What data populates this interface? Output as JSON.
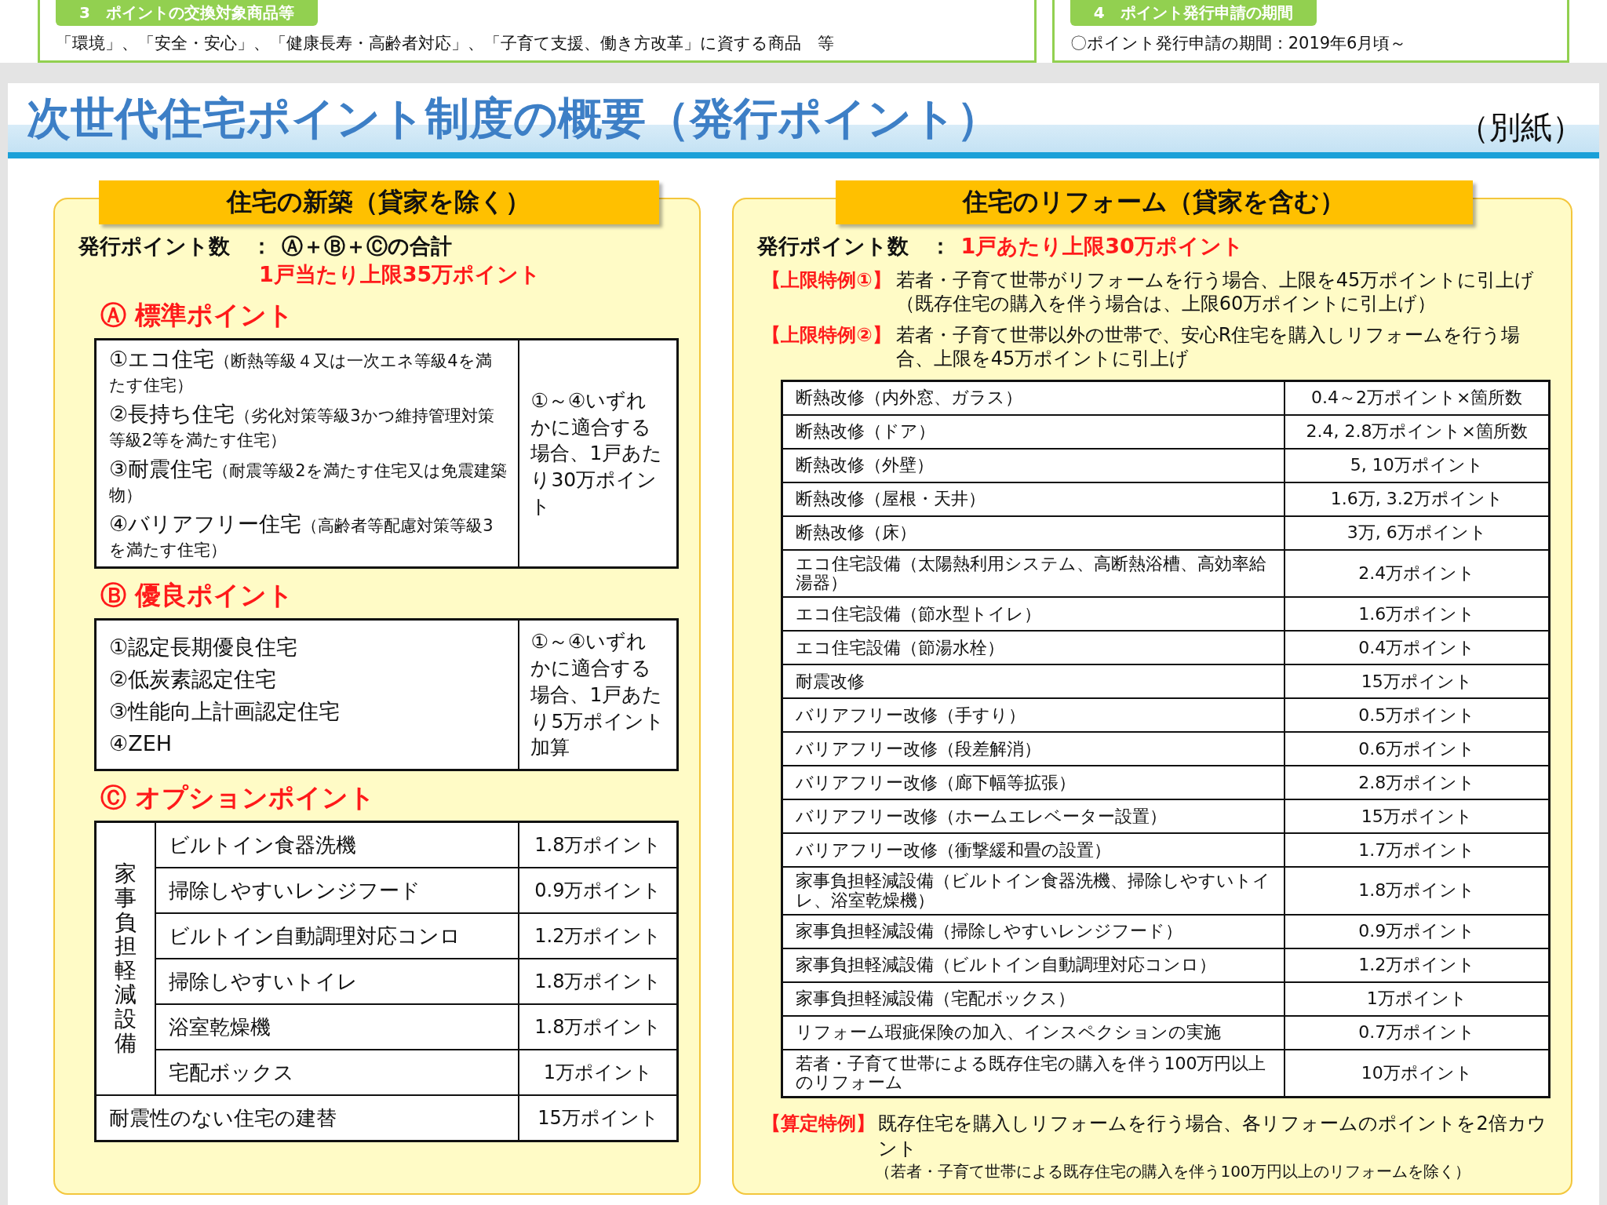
{
  "top_sections": [
    {
      "heading": "3　ポイントの交換対象商品等",
      "text": "「環境」、「安全・安心」、「健康長寿・高齢者対応」、「子育て支援、働き方改革」に資する商品　等"
    },
    {
      "heading": "4　ポイント発行申請の期間",
      "text": "〇ポイント発行申請の期間：2019年6月頃～"
    }
  ],
  "page": {
    "title": "次世代住宅ポイント制度の概要（発行ポイント）",
    "note": "（別紙）"
  },
  "new_build": {
    "heading": "住宅の新築（貸家を除く）",
    "count_label": "発行ポイント数　：",
    "count_value": "Ⓐ＋Ⓑ＋Ⓒの合計",
    "cap": "1戸当たり上限35万ポイント",
    "sections": [
      {
        "kind": "list",
        "heading": "Ⓐ 標準ポイント",
        "items": [
          {
            "name": "①エコ住宅",
            "detail": "（断熱等級４又は一次エネ等級4を満たす住宅）"
          },
          {
            "name": "②長持ち住宅",
            "detail": "（劣化対策等級3かつ維持管理対策等級2等を満たす住宅）"
          },
          {
            "name": "③耐震住宅",
            "detail": "（耐震等級2を満たす住宅又は免震建築物）"
          },
          {
            "name": "④バリアフリー住宅",
            "detail": "（高齢者等配慮対策等級3を満たす住宅）"
          }
        ],
        "note": "①～④いずれかに適合する場合、1戸あたり30万ポイント"
      },
      {
        "kind": "list",
        "heading": "Ⓑ 優良ポイント",
        "items": [
          {
            "name": "①認定長期優良住宅"
          },
          {
            "name": "②低炭素認定住宅"
          },
          {
            "name": "③性能向上計画認定住宅"
          },
          {
            "name": "④ZEH"
          }
        ],
        "note": "①～④いずれかに適合する場合、1戸あたり5万ポイント加算"
      },
      {
        "kind": "options",
        "heading": "Ⓒ オプションポイント",
        "group": "家事負担軽減設備",
        "rows": [
          {
            "item": "ビルトイン食器洗機",
            "points": "1.8万ポイント"
          },
          {
            "item": "掃除しやすいレンジフード",
            "points": "0.9万ポイント"
          },
          {
            "item": "ビルトイン自動調理対応コンロ",
            "points": "1.2万ポイント"
          },
          {
            "item": "掃除しやすいトイレ",
            "points": "1.8万ポイント"
          },
          {
            "item": "浴室乾燥機",
            "points": "1.8万ポイント"
          },
          {
            "item": "宅配ボックス",
            "points": "1万ポイント"
          }
        ],
        "extra": {
          "item": "耐震性のない住宅の建替",
          "points": "15万ポイント"
        }
      }
    ]
  },
  "reform": {
    "heading": "住宅のリフォーム（貸家を含む）",
    "count_label": "発行ポイント数　：",
    "count_value": "1戸あたり上限30万ポイント",
    "specials": [
      {
        "label": "【上限特例①】",
        "text": "若者・子育て世帯がリフォームを行う場合、上限を45万ポイントに引上げ（既存住宅の購入を伴う場合は、上限60万ポイントに引上げ）"
      },
      {
        "label": "【上限特例②】",
        "text": "若者・子育て世帯以外の世帯で、安心R住宅を購入しリフォームを行う場合、上限を45万ポイントに引上げ"
      }
    ],
    "rows": [
      {
        "item": "断熱改修（内外窓、ガラス）",
        "points": "0.4～2万ポイント×箇所数"
      },
      {
        "item": "断熱改修（ドア）",
        "points": "2.4, 2.8万ポイント×箇所数"
      },
      {
        "item": "断熱改修（外壁）",
        "points": "5, 10万ポイント"
      },
      {
        "item": "断熱改修（屋根・天井）",
        "points": "1.6万, 3.2万ポイント"
      },
      {
        "item": "断熱改修（床）",
        "points": "3万, 6万ポイント"
      },
      {
        "item": "エコ住宅設備（太陽熱利用システム、高断熱浴槽、高効率給湯器）",
        "points": "2.4万ポイント"
      },
      {
        "item": "エコ住宅設備（節水型トイレ）",
        "points": "1.6万ポイント"
      },
      {
        "item": "エコ住宅設備（節湯水栓）",
        "points": "0.4万ポイント"
      },
      {
        "item": "耐震改修",
        "points": "15万ポイント"
      },
      {
        "item": "バリアフリー改修（手すり）",
        "points": "0.5万ポイント"
      },
      {
        "item": "バリアフリー改修（段差解消）",
        "points": "0.6万ポイント"
      },
      {
        "item": "バリアフリー改修（廊下幅等拡張）",
        "points": "2.8万ポイント"
      },
      {
        "item": "バリアフリー改修（ホームエレベーター設置）",
        "points": "15万ポイント"
      },
      {
        "item": "バリアフリー改修（衝撃緩和畳の設置）",
        "points": "1.7万ポイント"
      },
      {
        "item": "家事負担軽減設備（ビルトイン食器洗機、掃除しやすいトイレ、浴室乾燥機）",
        "points": "1.8万ポイント"
      },
      {
        "item": "家事負担軽減設備（掃除しやすいレンジフード）",
        "points": "0.9万ポイント"
      },
      {
        "item": "家事負担軽減設備（ビルトイン自動調理対応コンロ）",
        "points": "1.2万ポイント"
      },
      {
        "item": "家事負担軽減設備（宅配ボックス）",
        "points": "1万ポイント"
      },
      {
        "item": "リフォーム瑕疵保険の加入、インスペクションの実施",
        "points": "0.7万ポイント"
      },
      {
        "item": "若者・子育て世帯による既存住宅の購入を伴う100万円以上のリフォーム",
        "points": "10万ポイント"
      }
    ],
    "footnote": {
      "label": "【算定特例】",
      "text": "既存住宅を購入しリフォームを行う場合、各リフォームのポイントを2倍カウント",
      "subtext": "（若者・子育て世帯による既存住宅の購入を伴う100万円以上のリフォームを除く）"
    }
  }
}
